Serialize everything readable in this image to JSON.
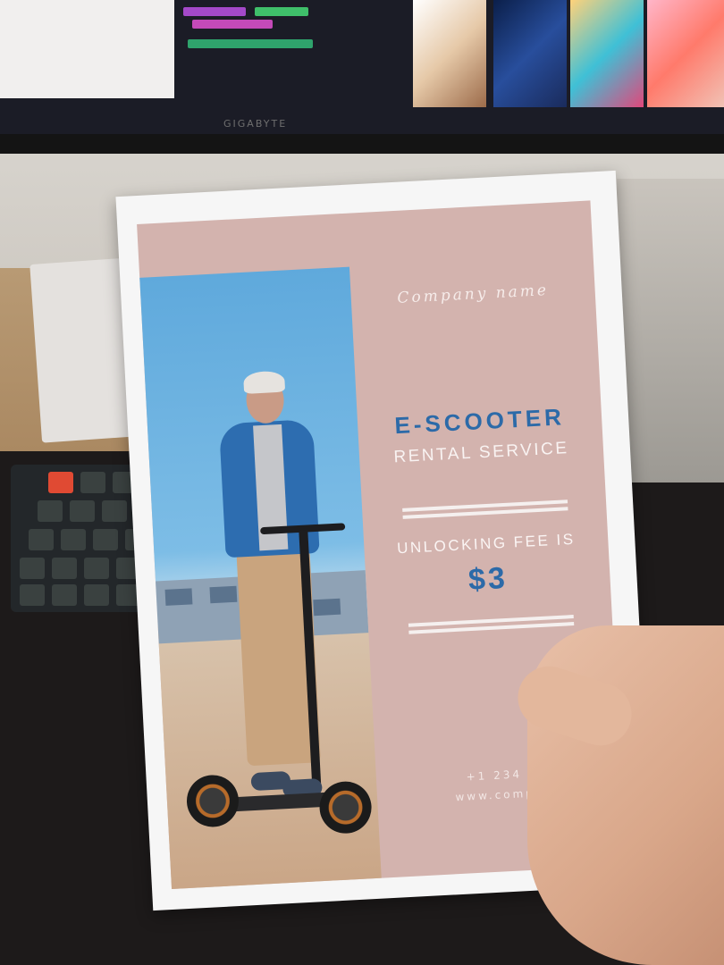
{
  "flyer": {
    "company_name": "Company name",
    "headline": "E-SCOOTER",
    "subheadline": "RENTAL SERVICE",
    "fee_label": "UNLOCKING FEE IS",
    "fee_value": "$3",
    "phone": "+1 234 567 8",
    "website": "www.company.c"
  },
  "monitor": {
    "brand": "GIGABYTE"
  },
  "colors": {
    "flyer_background": "#d3b3ae",
    "headline_blue": "#2c6aa8",
    "sky_blue": "#5fa9dc",
    "jacket_blue": "#2d6db0"
  }
}
